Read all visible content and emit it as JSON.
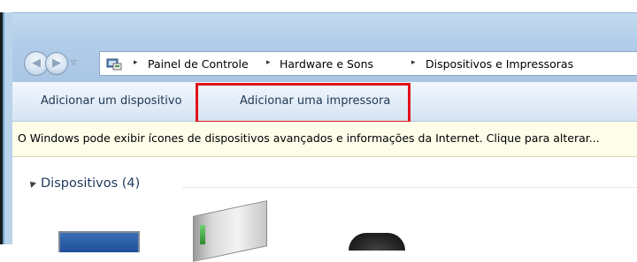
{
  "window": {
    "navigation": {
      "back_icon": "back-arrow-icon",
      "forward_icon": "forward-arrow-icon",
      "history_icon": "chevron-down-icon"
    },
    "address_bar": {
      "location_icon": "control-panel-icon",
      "breadcrumbs": [
        "Painel de Controle",
        "Hardware e Sons",
        "Dispositivos e Impressoras"
      ],
      "separator": "▸"
    },
    "command_bar": {
      "add_device": "Adicionar um dispositivo",
      "add_printer": "Adicionar uma impressora"
    },
    "info_bar": {
      "text": "O Windows pode exibir ícones de dispositivos avançados e informações da Internet. Clique para alterar..."
    },
    "content": {
      "group_title": "Dispositivos (4)"
    }
  },
  "colors": {
    "highlight": "#e2141b",
    "link_text": "#1e3653",
    "group_text": "#1e395b"
  }
}
